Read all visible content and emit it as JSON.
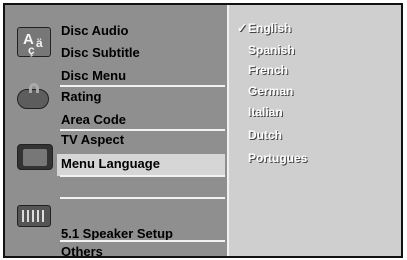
{
  "menu": {
    "items": [
      {
        "label": "Disc Audio"
      },
      {
        "label": "Disc Subtitle"
      },
      {
        "label": "Disc Menu"
      },
      {
        "label": "Rating"
      },
      {
        "label": "Area Code"
      },
      {
        "label": "TV Aspect"
      },
      {
        "label": "Menu Language"
      },
      {
        "label": "5.1 Speaker Setup"
      },
      {
        "label": "Others"
      }
    ],
    "icons": [
      "audio-subtitle-icon",
      "lock-icon",
      "tv-icon",
      "speaker-icon"
    ]
  },
  "languages": {
    "checkmark": "✓",
    "selected": "English",
    "options": [
      "English",
      "Spanish",
      "French",
      "German",
      "Italian",
      "Dutch",
      "Portugues"
    ]
  }
}
